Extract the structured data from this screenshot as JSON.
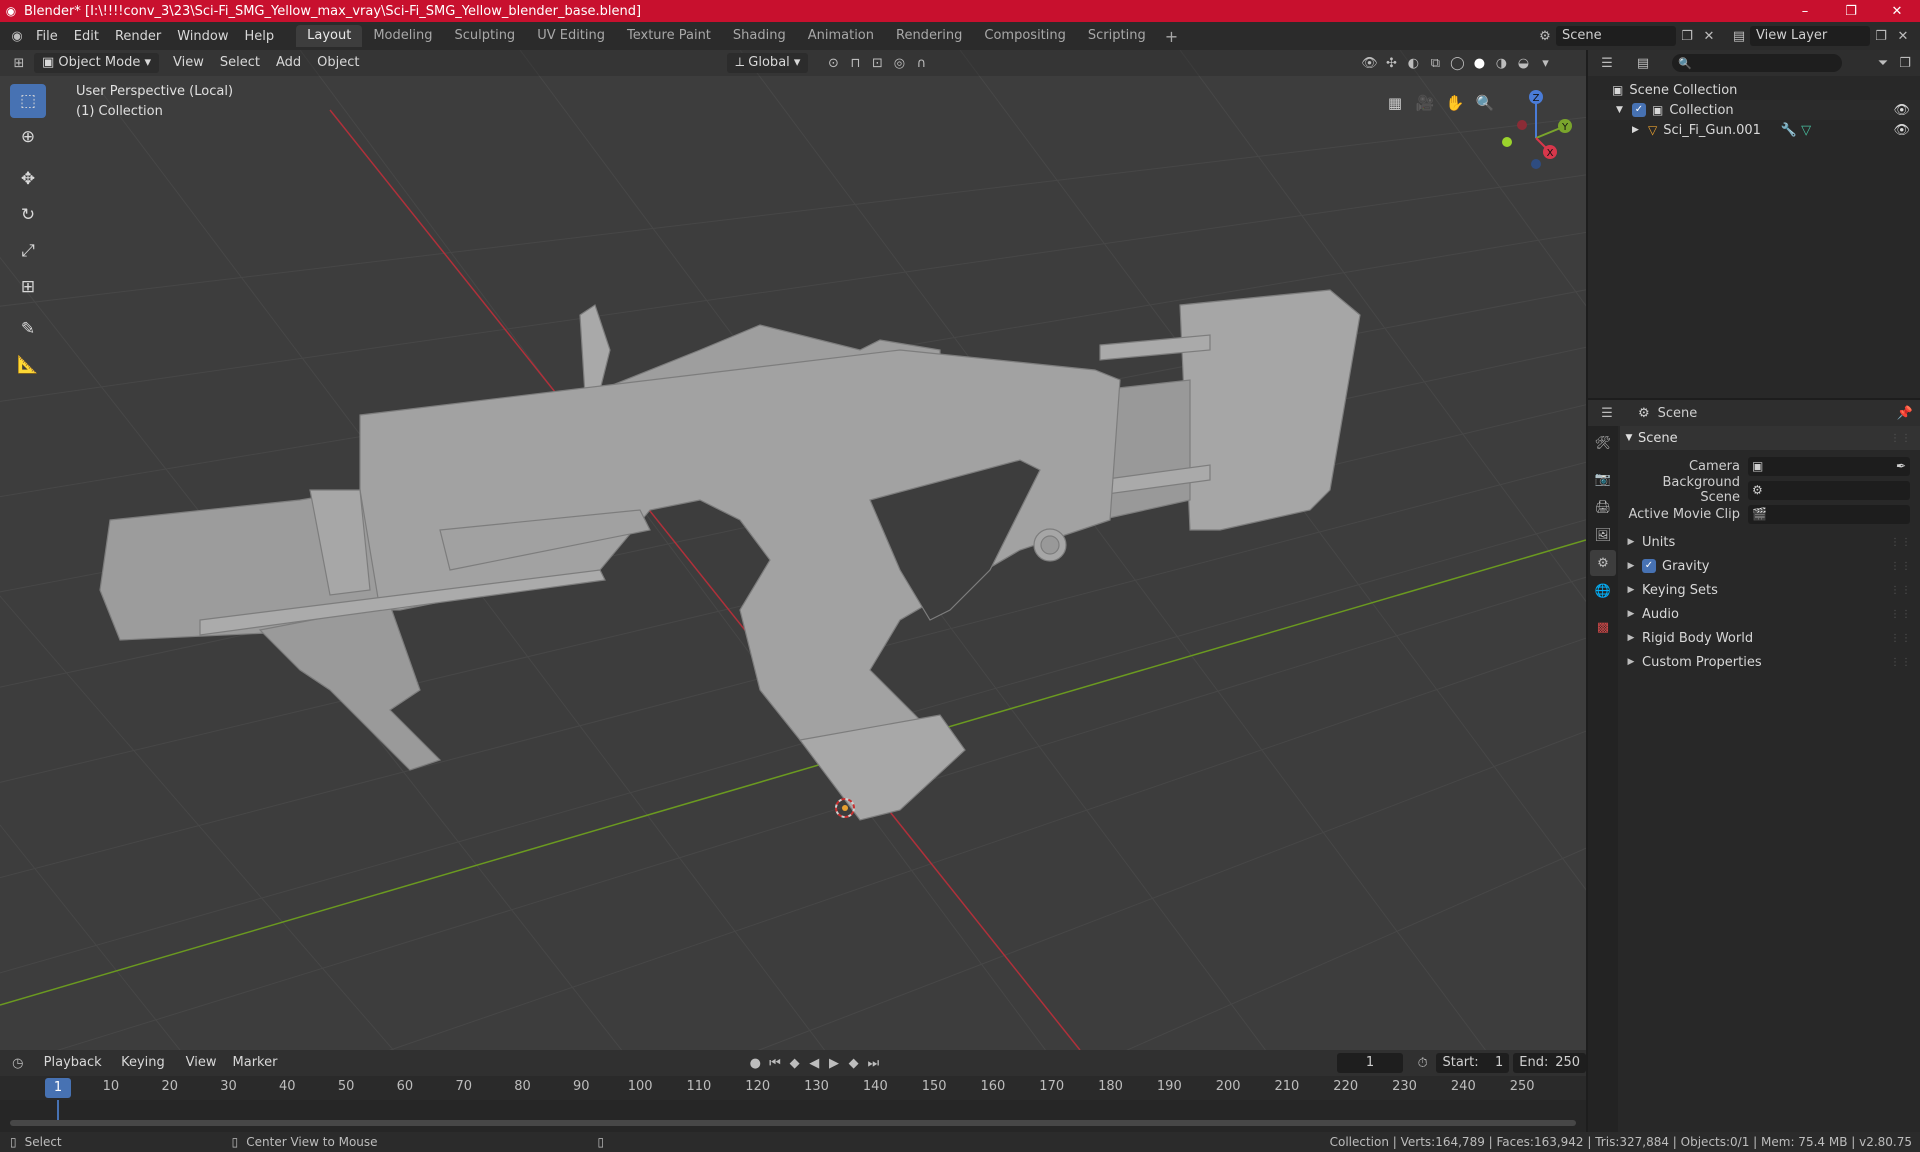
{
  "titlebar": {
    "title": "Blender* [I:\\!!!!conv_3\\23\\Sci-Fi_SMG_Yellow_max_vray\\Sci-Fi_SMG_Yellow_blender_base.blend]",
    "minimize": "–",
    "maximize": "❐",
    "close": "✕"
  },
  "menu": [
    "File",
    "Edit",
    "Render",
    "Window",
    "Help"
  ],
  "workspaces": [
    "Layout",
    "Modeling",
    "Sculpting",
    "UV Editing",
    "Texture Paint",
    "Shading",
    "Animation",
    "Rendering",
    "Compositing",
    "Scripting"
  ],
  "active_workspace": "Layout",
  "scene_field": "Scene",
  "view_layer_field": "View Layer",
  "viewport": {
    "mode": "Object Mode",
    "menus": [
      "View",
      "Select",
      "Add",
      "Object"
    ],
    "orientation": "Global",
    "info_line1": "User Perspective (Local)",
    "info_line2": "(1) Collection",
    "gizmo": {
      "x": "X",
      "y": "Y",
      "z": "Z"
    },
    "colors": {
      "background": "#3d3d3d",
      "grid": "#4a4a4a",
      "x_axis": "#c0303a",
      "y_axis": "#6b9a20",
      "model": "#a4a4a4",
      "active": "#4772b3"
    },
    "tools": [
      "select-box-icon",
      "cursor-icon",
      "move-icon",
      "rotate-icon",
      "scale-icon",
      "transform-icon",
      "annotate-icon",
      "measure-icon"
    ]
  },
  "outliner": {
    "search_placeholder": "",
    "root": "Scene Collection",
    "collection": "Collection",
    "object": "Sci_Fi_Gun.001"
  },
  "properties": {
    "context": "Scene",
    "panel": "Scene",
    "camera_label": "Camera",
    "background_scene_label": "Background Scene",
    "active_movie_clip_label": "Active Movie Clip",
    "subpanels": {
      "units": "Units",
      "gravity": "Gravity",
      "keying_sets": "Keying Sets",
      "audio": "Audio",
      "rigid_body_world": "Rigid Body World",
      "custom_properties": "Custom Properties"
    }
  },
  "timeline": {
    "menus": [
      "Playback",
      "Keying",
      "View",
      "Marker"
    ],
    "current_frame": "1",
    "start_label": "Start:",
    "start": "1",
    "end_label": "End:",
    "end": "250",
    "ticks": [
      "1",
      "10",
      "20",
      "30",
      "40",
      "50",
      "60",
      "70",
      "80",
      "90",
      "100",
      "110",
      "120",
      "130",
      "140",
      "150",
      "160",
      "170",
      "180",
      "190",
      "200",
      "210",
      "220",
      "230",
      "240",
      "250"
    ]
  },
  "statusbar": {
    "select": "Select",
    "center": "Center View to Mouse",
    "stats": "Collection | Verts:164,789 | Faces:163,942 | Tris:327,884 | Objects:0/1 | Mem: 75.4 MB | v2.80.75"
  }
}
